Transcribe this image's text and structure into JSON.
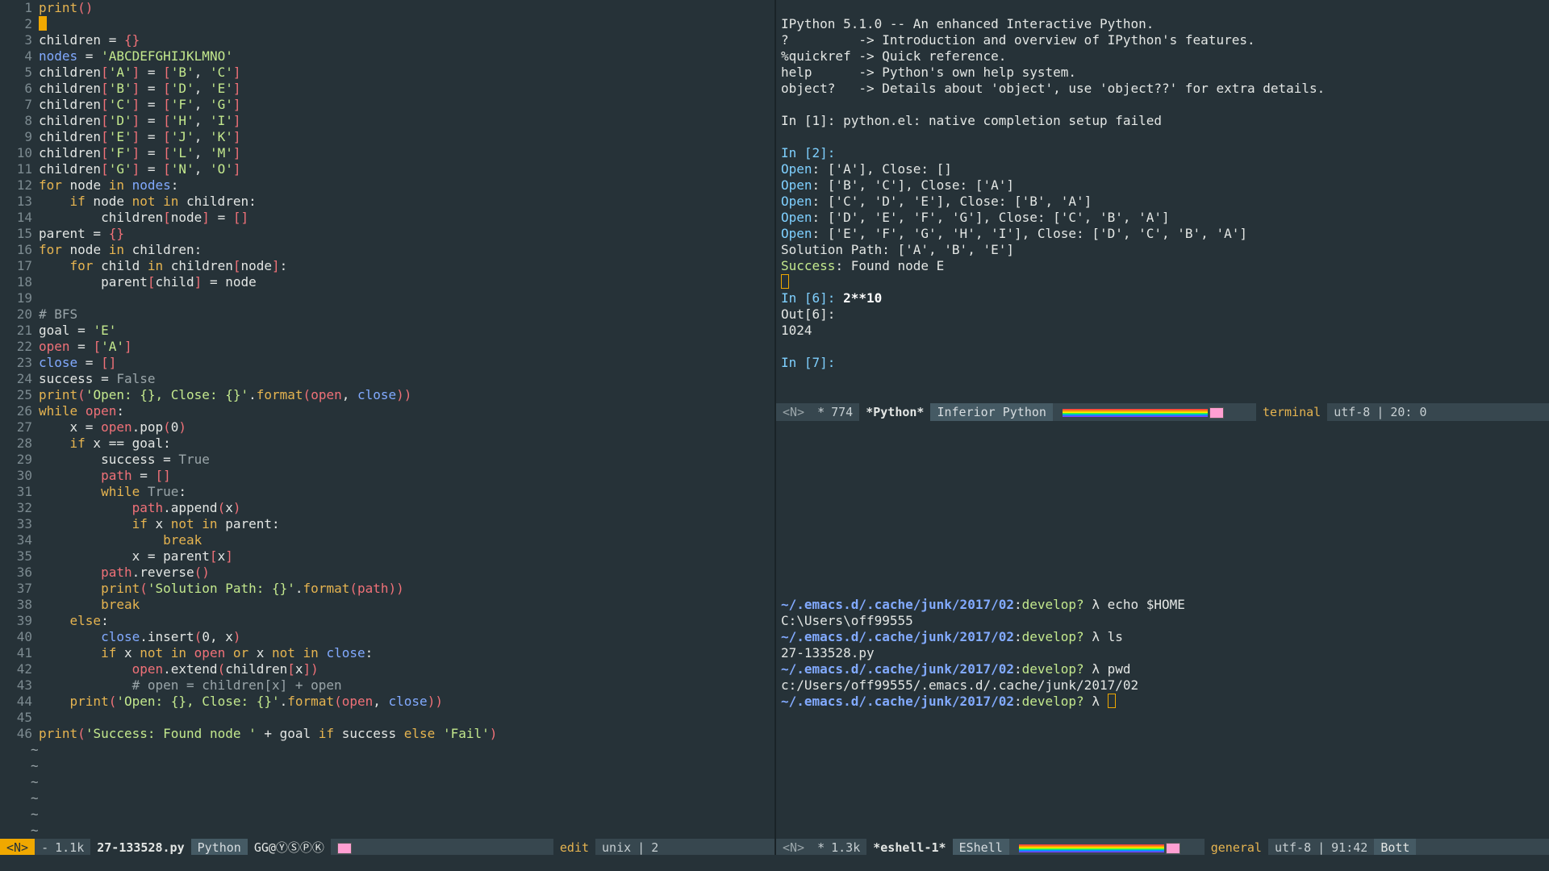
{
  "editor": {
    "lines": [
      [
        [
          "fn",
          "print"
        ],
        [
          "br",
          "()"
        ]
      ],
      [],
      [
        [
          "out",
          "children = "
        ],
        [
          "br",
          "{}"
        ]
      ],
      [
        [
          "bl",
          "nodes"
        ],
        [
          "out",
          " = "
        ],
        [
          "str",
          "'ABCDEFGHIJKLMNO'"
        ]
      ],
      [
        [
          "out",
          "children"
        ],
        [
          "br",
          "["
        ],
        [
          "str",
          "'A'"
        ],
        [
          "br",
          "]"
        ],
        [
          "out",
          " = "
        ],
        [
          "br",
          "["
        ],
        [
          "str",
          "'B'"
        ],
        [
          "out",
          ", "
        ],
        [
          "str",
          "'C'"
        ],
        [
          "br",
          "]"
        ]
      ],
      [
        [
          "out",
          "children"
        ],
        [
          "br",
          "["
        ],
        [
          "str",
          "'B'"
        ],
        [
          "br",
          "]"
        ],
        [
          "out",
          " = "
        ],
        [
          "br",
          "["
        ],
        [
          "str",
          "'D'"
        ],
        [
          "out",
          ", "
        ],
        [
          "str",
          "'E'"
        ],
        [
          "br",
          "]"
        ]
      ],
      [
        [
          "out",
          "children"
        ],
        [
          "br",
          "["
        ],
        [
          "str",
          "'C'"
        ],
        [
          "br",
          "]"
        ],
        [
          "out",
          " = "
        ],
        [
          "br",
          "["
        ],
        [
          "str",
          "'F'"
        ],
        [
          "out",
          ", "
        ],
        [
          "str",
          "'G'"
        ],
        [
          "br",
          "]"
        ]
      ],
      [
        [
          "out",
          "children"
        ],
        [
          "br",
          "["
        ],
        [
          "str",
          "'D'"
        ],
        [
          "br",
          "]"
        ],
        [
          "out",
          " = "
        ],
        [
          "br",
          "["
        ],
        [
          "str",
          "'H'"
        ],
        [
          "out",
          ", "
        ],
        [
          "str",
          "'I'"
        ],
        [
          "br",
          "]"
        ]
      ],
      [
        [
          "out",
          "children"
        ],
        [
          "br",
          "["
        ],
        [
          "str",
          "'E'"
        ],
        [
          "br",
          "]"
        ],
        [
          "out",
          " = "
        ],
        [
          "br",
          "["
        ],
        [
          "str",
          "'J'"
        ],
        [
          "out",
          ", "
        ],
        [
          "str",
          "'K'"
        ],
        [
          "br",
          "]"
        ]
      ],
      [
        [
          "out",
          "children"
        ],
        [
          "br",
          "["
        ],
        [
          "str",
          "'F'"
        ],
        [
          "br",
          "]"
        ],
        [
          "out",
          " = "
        ],
        [
          "br",
          "["
        ],
        [
          "str",
          "'L'"
        ],
        [
          "out",
          ", "
        ],
        [
          "str",
          "'M'"
        ],
        [
          "br",
          "]"
        ]
      ],
      [
        [
          "out",
          "children"
        ],
        [
          "br",
          "["
        ],
        [
          "str",
          "'G'"
        ],
        [
          "br",
          "]"
        ],
        [
          "out",
          " = "
        ],
        [
          "br",
          "["
        ],
        [
          "str",
          "'N'"
        ],
        [
          "out",
          ", "
        ],
        [
          "str",
          "'O'"
        ],
        [
          "br",
          "]"
        ]
      ],
      [
        [
          "kw",
          "for"
        ],
        [
          "out",
          " node "
        ],
        [
          "kw",
          "in"
        ],
        [
          "out",
          " "
        ],
        [
          "bl",
          "nodes"
        ],
        [
          "out",
          ":"
        ]
      ],
      [
        [
          "out",
          "    "
        ],
        [
          "kw",
          "if"
        ],
        [
          "out",
          " node "
        ],
        [
          "kw",
          "not in"
        ],
        [
          "out",
          " children:"
        ]
      ],
      [
        [
          "out",
          "        children"
        ],
        [
          "br",
          "["
        ],
        [
          "out",
          "node"
        ],
        [
          "br",
          "]"
        ],
        [
          "out",
          " = "
        ],
        [
          "br",
          "[]"
        ]
      ],
      [
        [
          "out",
          "parent = "
        ],
        [
          "br",
          "{}"
        ]
      ],
      [
        [
          "kw",
          "for"
        ],
        [
          "out",
          " node "
        ],
        [
          "kw",
          "in"
        ],
        [
          "out",
          " children:"
        ]
      ],
      [
        [
          "out",
          "    "
        ],
        [
          "kw",
          "for"
        ],
        [
          "out",
          " child "
        ],
        [
          "kw",
          "in"
        ],
        [
          "out",
          " children"
        ],
        [
          "br",
          "["
        ],
        [
          "out",
          "node"
        ],
        [
          "br",
          "]"
        ],
        [
          "out",
          ":"
        ]
      ],
      [
        [
          "out",
          "        parent"
        ],
        [
          "br",
          "["
        ],
        [
          "out",
          "child"
        ],
        [
          "br",
          "]"
        ],
        [
          "out",
          " = node"
        ]
      ],
      [],
      [
        [
          "cm",
          "# BFS"
        ]
      ],
      [
        [
          "out",
          "goal = "
        ],
        [
          "str",
          "'E'"
        ]
      ],
      [
        [
          "vr",
          "open"
        ],
        [
          "out",
          " = "
        ],
        [
          "br",
          "["
        ],
        [
          "str",
          "'A'"
        ],
        [
          "br",
          "]"
        ]
      ],
      [
        [
          "bl",
          "close"
        ],
        [
          "out",
          " = "
        ],
        [
          "br",
          "[]"
        ]
      ],
      [
        [
          "out",
          "success = "
        ],
        [
          "cm",
          "False"
        ]
      ],
      [
        [
          "fn",
          "print"
        ],
        [
          "br",
          "("
        ],
        [
          "str",
          "'Open: {}, Close: {}'"
        ],
        [
          "out",
          "."
        ],
        [
          "fn",
          "format"
        ],
        [
          "br",
          "("
        ],
        [
          "vr",
          "open"
        ],
        [
          "out",
          ", "
        ],
        [
          "bl",
          "close"
        ],
        [
          "br",
          "))"
        ]
      ],
      [
        [
          "kw",
          "while"
        ],
        [
          "out",
          " "
        ],
        [
          "vr",
          "open"
        ],
        [
          "out",
          ":"
        ]
      ],
      [
        [
          "out",
          "    x = "
        ],
        [
          "vr",
          "open"
        ],
        [
          "out",
          ".pop"
        ],
        [
          "br",
          "("
        ],
        [
          "out",
          "0"
        ],
        [
          "br",
          ")"
        ]
      ],
      [
        [
          "out",
          "    "
        ],
        [
          "kw",
          "if"
        ],
        [
          "out",
          " x == goal:"
        ]
      ],
      [
        [
          "out",
          "        success = "
        ],
        [
          "cm",
          "True"
        ]
      ],
      [
        [
          "out",
          "        "
        ],
        [
          "vr",
          "path"
        ],
        [
          "out",
          " = "
        ],
        [
          "br",
          "[]"
        ]
      ],
      [
        [
          "out",
          "        "
        ],
        [
          "kw",
          "while"
        ],
        [
          "out",
          " "
        ],
        [
          "cm",
          "True"
        ],
        [
          "out",
          ":"
        ]
      ],
      [
        [
          "out",
          "            "
        ],
        [
          "vr",
          "path"
        ],
        [
          "out",
          ".append"
        ],
        [
          "br",
          "("
        ],
        [
          "out",
          "x"
        ],
        [
          "br",
          ")"
        ]
      ],
      [
        [
          "out",
          "            "
        ],
        [
          "kw",
          "if"
        ],
        [
          "out",
          " x "
        ],
        [
          "kw",
          "not in"
        ],
        [
          "out",
          " parent:"
        ]
      ],
      [
        [
          "out",
          "                "
        ],
        [
          "kw",
          "break"
        ]
      ],
      [
        [
          "out",
          "            x = parent"
        ],
        [
          "br",
          "["
        ],
        [
          "out",
          "x"
        ],
        [
          "br",
          "]"
        ]
      ],
      [
        [
          "out",
          "        "
        ],
        [
          "vr",
          "path"
        ],
        [
          "out",
          ".reverse"
        ],
        [
          "br",
          "()"
        ]
      ],
      [
        [
          "out",
          "        "
        ],
        [
          "fn",
          "print"
        ],
        [
          "br",
          "("
        ],
        [
          "str",
          "'Solution Path: {}'"
        ],
        [
          "out",
          "."
        ],
        [
          "fn",
          "format"
        ],
        [
          "br",
          "("
        ],
        [
          "vr",
          "path"
        ],
        [
          "br",
          "))"
        ]
      ],
      [
        [
          "out",
          "        "
        ],
        [
          "kw",
          "break"
        ]
      ],
      [
        [
          "out",
          "    "
        ],
        [
          "kw",
          "else"
        ],
        [
          "out",
          ":"
        ]
      ],
      [
        [
          "out",
          "        "
        ],
        [
          "bl",
          "close"
        ],
        [
          "out",
          ".insert"
        ],
        [
          "br",
          "("
        ],
        [
          "out",
          "0, x"
        ],
        [
          "br",
          ")"
        ]
      ],
      [
        [
          "out",
          "        "
        ],
        [
          "kw",
          "if"
        ],
        [
          "out",
          " x "
        ],
        [
          "kw",
          "not in"
        ],
        [
          "out",
          " "
        ],
        [
          "vr",
          "open"
        ],
        [
          "out",
          " "
        ],
        [
          "kw",
          "or"
        ],
        [
          "out",
          " x "
        ],
        [
          "kw",
          "not in"
        ],
        [
          "out",
          " "
        ],
        [
          "bl",
          "close"
        ],
        [
          "out",
          ":"
        ]
      ],
      [
        [
          "out",
          "            "
        ],
        [
          "vr",
          "open"
        ],
        [
          "out",
          ".extend"
        ],
        [
          "br",
          "("
        ],
        [
          "out",
          "children"
        ],
        [
          "br",
          "["
        ],
        [
          "out",
          "x"
        ],
        [
          "br",
          "])"
        ]
      ],
      [
        [
          "out",
          "            "
        ],
        [
          "cm",
          "# open = children[x] + open"
        ]
      ],
      [
        [
          "out",
          "    "
        ],
        [
          "fn",
          "print"
        ],
        [
          "br",
          "("
        ],
        [
          "str",
          "'Open: {}, Close: {}'"
        ],
        [
          "out",
          "."
        ],
        [
          "fn",
          "format"
        ],
        [
          "br",
          "("
        ],
        [
          "vr",
          "open"
        ],
        [
          "out",
          ", "
        ],
        [
          "bl",
          "close"
        ],
        [
          "br",
          "))"
        ]
      ],
      [],
      [
        [
          "fn",
          "print"
        ],
        [
          "br",
          "("
        ],
        [
          "str",
          "'Success: Found node '"
        ],
        [
          "out",
          " + goal "
        ],
        [
          "kw",
          "if"
        ],
        [
          "out",
          " success "
        ],
        [
          "kw",
          "else"
        ],
        [
          "out",
          " "
        ],
        [
          "str",
          "'Fail'"
        ],
        [
          "br",
          ")"
        ]
      ]
    ],
    "tilde_count": 6,
    "tilde_char": "~"
  },
  "ipython": {
    "lines": [
      [
        [
          "out",
          "IPython 5.1.0 -- An enhanced Interactive Python."
        ]
      ],
      [
        [
          "out",
          "?         -> Introduction and overview of IPython's features."
        ]
      ],
      [
        [
          "out",
          "%quickref -> Quick reference."
        ]
      ],
      [
        [
          "out",
          "help      -> Python's own help system."
        ]
      ],
      [
        [
          "out",
          "object?   -> Details about 'object', use 'object??' for extra details."
        ]
      ],
      [],
      [
        [
          "out",
          "In [1]: python.el: native completion setup failed"
        ]
      ],
      [],
      [
        [
          "cy",
          "In [2]:"
        ]
      ],
      [
        [
          "cy",
          "Open"
        ],
        [
          "out",
          ": ['A'], Close: []"
        ]
      ],
      [
        [
          "cy",
          "Open"
        ],
        [
          "out",
          ": ['B', 'C'], Close: ['A']"
        ]
      ],
      [
        [
          "cy",
          "Open"
        ],
        [
          "out",
          ": ['C', 'D', 'E'], Close: ['B', 'A']"
        ]
      ],
      [
        [
          "cy",
          "Open"
        ],
        [
          "out",
          ": ['D', 'E', 'F', 'G'], Close: ['C', 'B', 'A']"
        ]
      ],
      [
        [
          "cy",
          "Open"
        ],
        [
          "out",
          ": ['E', 'F', 'G', 'H', 'I'], Close: ['D', 'C', 'B', 'A']"
        ]
      ],
      [
        [
          "out",
          "Solution Path: ['A', 'B', 'E']"
        ]
      ],
      [
        [
          "gr",
          "Success"
        ],
        [
          "out",
          ": Found node E"
        ]
      ]
    ],
    "after_cursor": [
      [
        [
          "cy",
          "In [6]: "
        ],
        [
          "bold",
          "2**10"
        ]
      ],
      [
        [
          "out",
          "Out[6]:"
        ]
      ],
      [
        [
          "out",
          "1024"
        ]
      ],
      [],
      [
        [
          "cy",
          "In [7]:"
        ]
      ]
    ]
  },
  "eshell": {
    "lines": [
      {
        "path": "~/.emacs.d/.cache/junk/2017/02",
        "branch": "develop?",
        "lambda": " λ ",
        "cmd": "echo $HOME",
        "output": "C:\\Users\\off99555"
      },
      {
        "path": "~/.emacs.d/.cache/junk/2017/02",
        "branch": "develop?",
        "lambda": " λ ",
        "cmd": "ls",
        "output": "27-133528.py"
      },
      {
        "path": "~/.emacs.d/.cache/junk/2017/02",
        "branch": "develop?",
        "lambda": " λ ",
        "cmd": "pwd",
        "output": "c:/Users/off99555/.emacs.d/.cache/junk/2017/02"
      }
    ],
    "final_prompt": {
      "path": "~/.emacs.d/.cache/junk/2017/02",
      "branch": "develop?",
      "lambda": " λ "
    }
  },
  "modeline_left": {
    "state": "<N>",
    "modified": "-",
    "size": "1.1k",
    "file": "27-133528.py",
    "mode": "Python",
    "minor": "GG@ⓎⓈⓅⓀ",
    "project": "edit",
    "eol": "unix",
    "sep": "|",
    "pos": "2"
  },
  "modeline_ipy": {
    "state": "<N>",
    "modified": "*",
    "size": "774",
    "buffer": "*Python*",
    "mode": "Inferior Python",
    "project": "terminal",
    "enc": "utf-8",
    "sep": "|",
    "pos": "20: 0"
  },
  "modeline_esh": {
    "state": "<N>",
    "modified": "*",
    "size": "1.3k",
    "buffer": "*eshell-1*",
    "mode": "EShell",
    "project": "general",
    "enc": "utf-8",
    "sep": "|",
    "pos": "91:42",
    "scroll": "Bott"
  }
}
